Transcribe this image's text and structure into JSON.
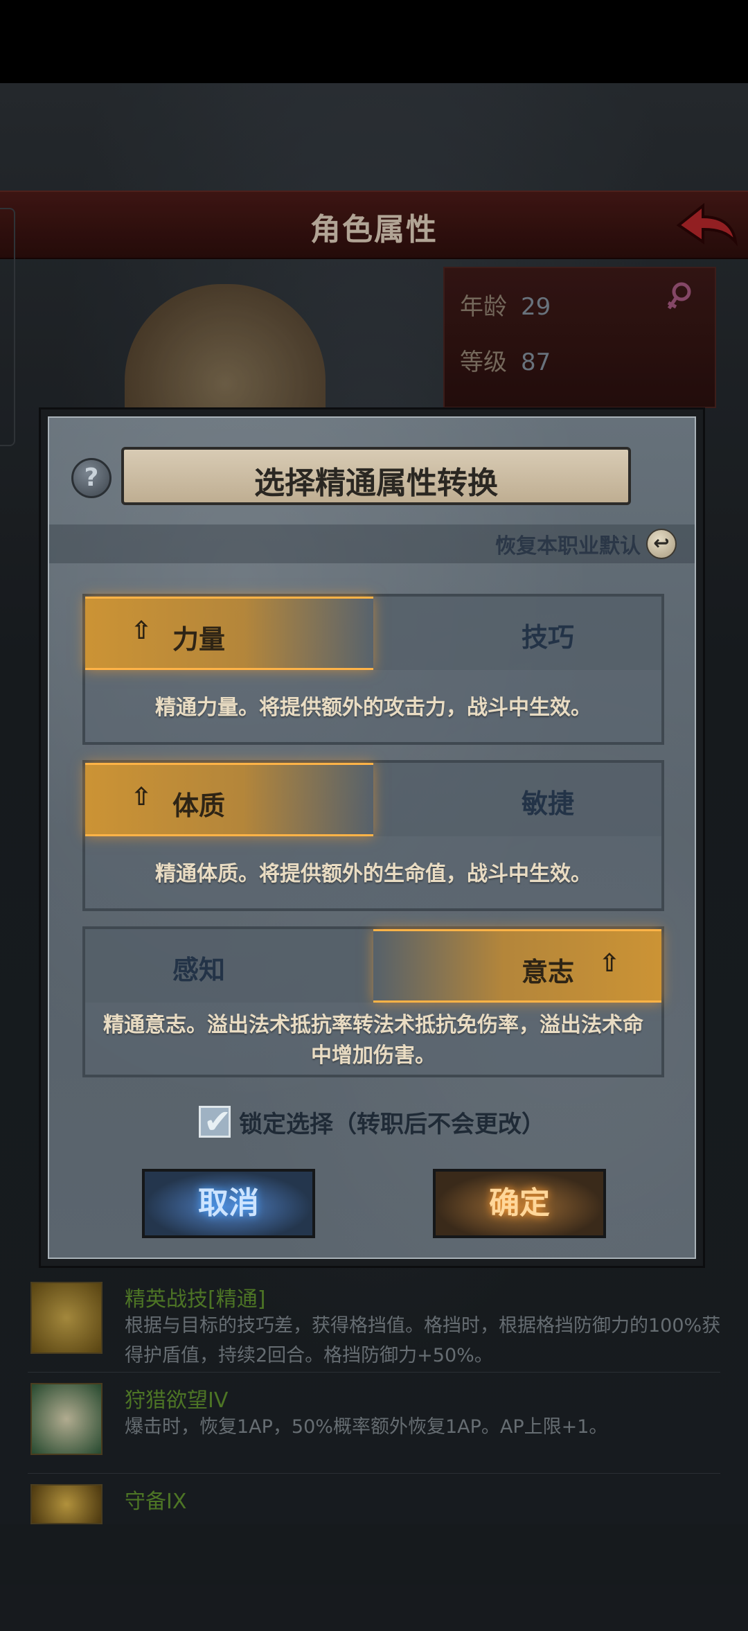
{
  "screen": {
    "header_title": "角色属性",
    "info": {
      "age_label": "年龄",
      "age_value": "29",
      "level_label": "等级",
      "level_value": "87"
    },
    "skills": [
      {
        "name": "精英战技[精通]",
        "desc": "根据与目标的技巧差，获得格挡值。格挡时，根据格挡防御力的100%获得护盾值，持续2回合。格挡防御力+50%。"
      },
      {
        "name": "狩猎欲望IV",
        "desc": "爆击时，恢复1AP，50%概率额外恢复1AP。AP上限+1。"
      },
      {
        "name": "守备IX",
        "desc": ""
      }
    ]
  },
  "dialog": {
    "title": "选择精通属性转换",
    "restore_default": "恢复本职业默认",
    "attribute_pairs": [
      {
        "left": "力量",
        "right": "技巧",
        "selected": "left",
        "desc": "精通力量。将提供额外的攻击力，战斗中生效。"
      },
      {
        "left": "体质",
        "right": "敏捷",
        "selected": "left",
        "desc": "精通体质。将提供额外的生命值，战斗中生效。"
      },
      {
        "left": "感知",
        "right": "意志",
        "selected": "right",
        "desc": "精通意志。溢出法术抵抗率转法术抵抗免伤率，溢出法术命中增加伤害。"
      }
    ],
    "lock_label": "锁定选择（转职后不会更改）",
    "lock_checked": true,
    "cancel_label": "取消",
    "confirm_label": "确定"
  },
  "colors": {
    "selected_option": "#d2963a",
    "cancel_glow": "#4aa3ff",
    "confirm_glow": "#ff9b30"
  }
}
